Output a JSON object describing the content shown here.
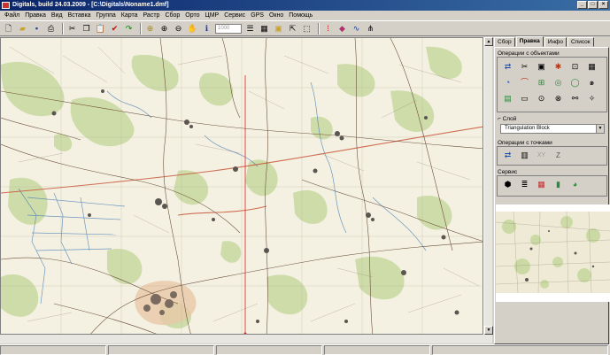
{
  "window": {
    "title": "Digitals, build 24.03.2009 - [C:\\Digitals\\Noname1.dmf]"
  },
  "menu": [
    "Файл",
    "Правка",
    "Вид",
    "Вставка",
    "Группа",
    "Карта",
    "Растр",
    "Сбор",
    "Орто",
    "ЦМР",
    "Сервис",
    "GPS",
    "Окно",
    "Помощь"
  ],
  "toolbar": {
    "zoom_value": "1000"
  },
  "panel": {
    "tabs": [
      "Сбор",
      "Правка",
      "Инфо",
      "Список"
    ],
    "active_tab": "Правка",
    "objects_section": "Операции с объектами",
    "layer_section": "Слой",
    "layer_value": "Triangulation Block",
    "points_section": "Операции с точками",
    "service_section": "Сервис",
    "points_labels": [
      "XY",
      "Z"
    ]
  },
  "colors": {
    "title_start": "#0a246a",
    "title_end": "#3a6ea5",
    "map_bg": "#f3f1e4",
    "forest": "#c8d9a0",
    "river": "#4a7fb5",
    "road": "#c8563a"
  }
}
